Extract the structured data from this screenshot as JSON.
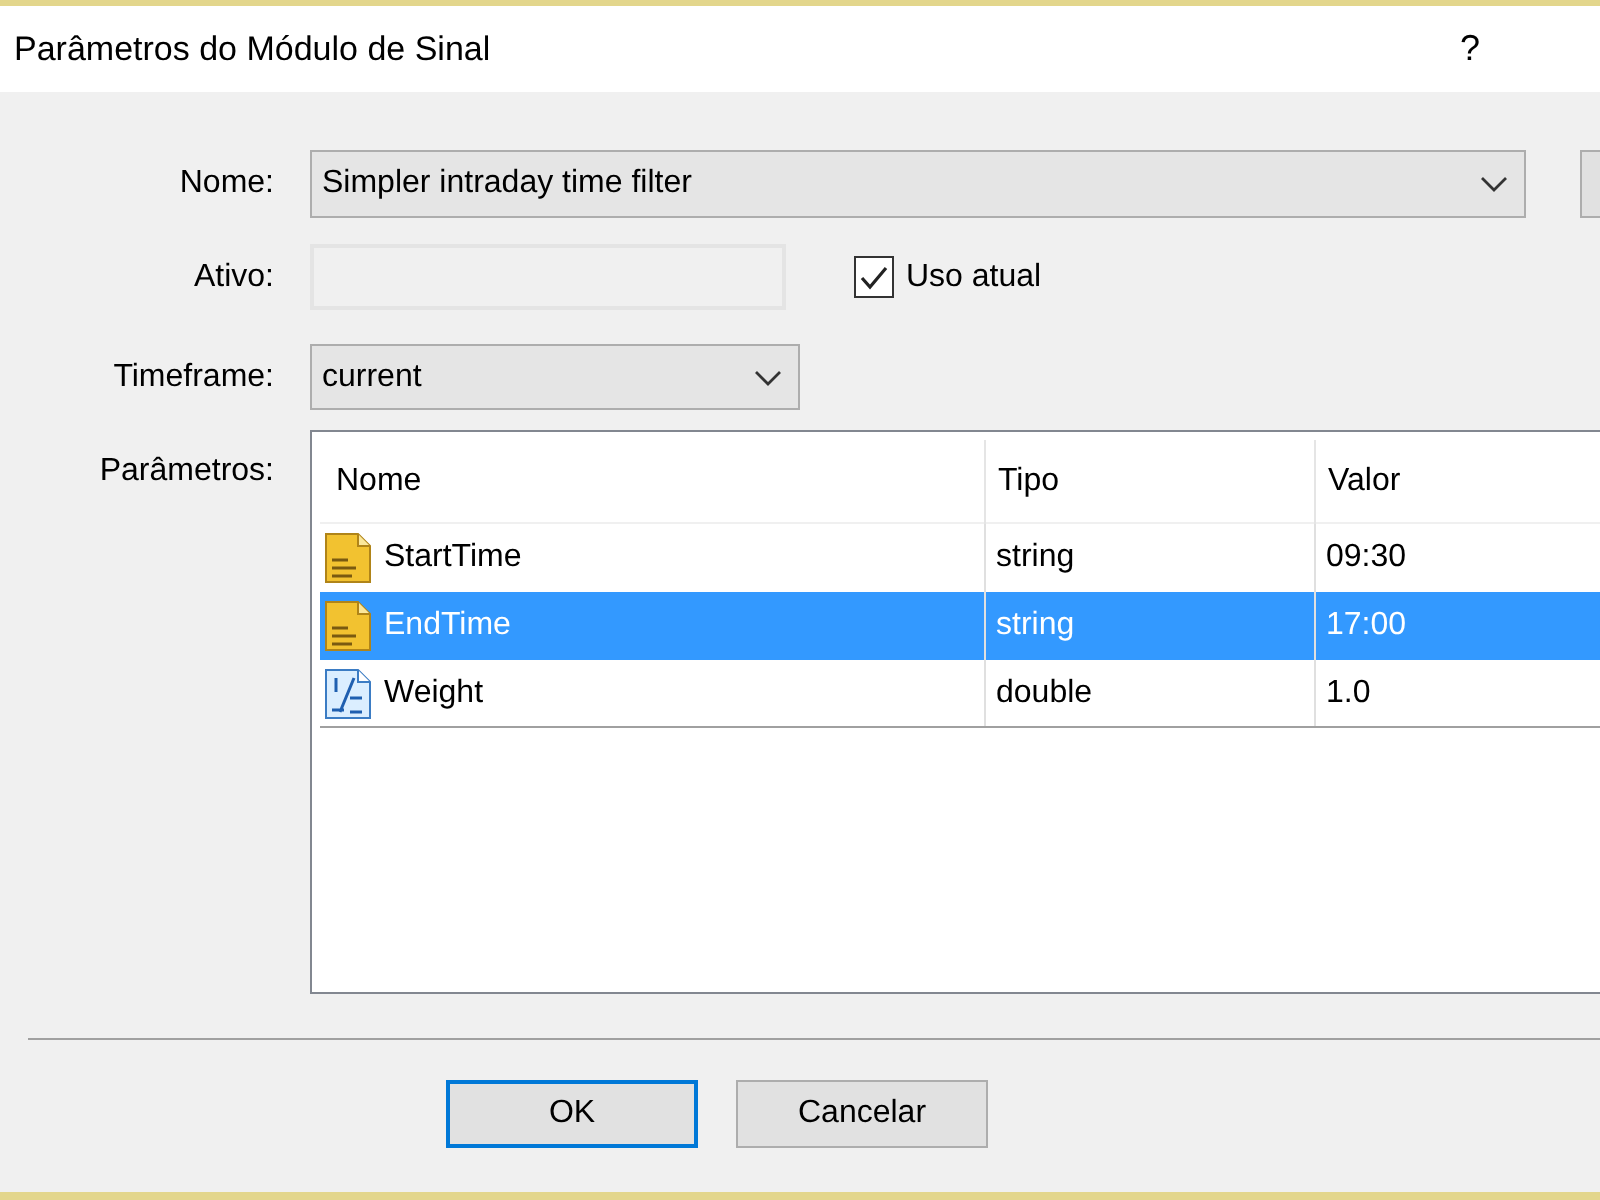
{
  "window": {
    "title": "Parâmetros do Módulo de Sinal",
    "help": "?"
  },
  "form": {
    "name": {
      "label": "Nome:",
      "value": "Simpler intraday time filter"
    },
    "symbol": {
      "label": "Ativo:"
    },
    "use_current": {
      "label": "Uso atual",
      "checked": true
    },
    "timeframe": {
      "label": "Timeframe:",
      "value": "current"
    },
    "parameters_label": "Parâmetros:"
  },
  "table": {
    "columns": [
      "Nome",
      "Tipo",
      "Valor"
    ],
    "rows": [
      {
        "kind": "text",
        "name": "StartTime",
        "type": "string",
        "value": "09:30",
        "selected": false
      },
      {
        "kind": "text",
        "name": "EndTime",
        "type": "string",
        "value": "17:00",
        "selected": true
      },
      {
        "kind": "number",
        "name": "Weight",
        "type": "double",
        "value": "1.0",
        "selected": false
      }
    ]
  },
  "buttons": [
    {
      "label": "OK",
      "default": true
    },
    {
      "label": "Cancelar",
      "default": false
    }
  ]
}
